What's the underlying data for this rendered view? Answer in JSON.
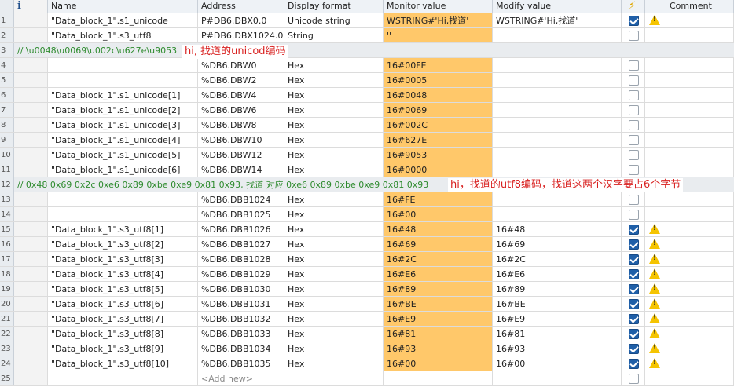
{
  "header": {
    "info_icon": "i",
    "name": "Name",
    "address": "Address",
    "display_format": "Display format",
    "monitor_value": "Monitor value",
    "modify_value": "Modify value",
    "bolt_icon": "⚡",
    "comment": "Comment"
  },
  "rows": [
    {
      "num": "1",
      "name": "\"Data_block_1\".s1_unicode",
      "address": "P#DB6.DBX0.0",
      "format": "Unicode string",
      "monitor": "WSTRING#'Hi,找道'",
      "modify": "WSTRING#'Hi,找道'",
      "checked": true,
      "warn": true
    },
    {
      "num": "2",
      "name": "\"Data_block_1\".s3_utf8",
      "address": "P#DB6.DBX1024.0",
      "format": "String",
      "monitor": "''",
      "modify": "",
      "checked": false,
      "warn": false
    },
    {
      "num": "3",
      "comment": "// \\u0048\\u0069\\u002c\\u627e\\u9053"
    },
    {
      "num": "4",
      "name": "",
      "address": "%DB6.DBW0",
      "format": "Hex",
      "monitor": "16#00FE",
      "modify": "",
      "checked": false,
      "warn": false
    },
    {
      "num": "5",
      "name": "",
      "address": "%DB6.DBW2",
      "format": "Hex",
      "monitor": "16#0005",
      "modify": "",
      "checked": false,
      "warn": false
    },
    {
      "num": "6",
      "name": "\"Data_block_1\".s1_unicode[1]",
      "address": "%DB6.DBW4",
      "format": "Hex",
      "monitor": "16#0048",
      "modify": "",
      "checked": false,
      "warn": false
    },
    {
      "num": "7",
      "name": "\"Data_block_1\".s1_unicode[2]",
      "address": "%DB6.DBW6",
      "format": "Hex",
      "monitor": "16#0069",
      "modify": "",
      "checked": false,
      "warn": false
    },
    {
      "num": "8",
      "name": "\"Data_block_1\".s1_unicode[3]",
      "address": "%DB6.DBW8",
      "format": "Hex",
      "monitor": "16#002C",
      "modify": "",
      "checked": false,
      "warn": false
    },
    {
      "num": "9",
      "name": "\"Data_block_1\".s1_unicode[4]",
      "address": "%DB6.DBW10",
      "format": "Hex",
      "monitor": "16#627E",
      "modify": "",
      "checked": false,
      "warn": false
    },
    {
      "num": "10",
      "name": "\"Data_block_1\".s1_unicode[5]",
      "address": "%DB6.DBW12",
      "format": "Hex",
      "monitor": "16#9053",
      "modify": "",
      "checked": false,
      "warn": false
    },
    {
      "num": "11",
      "name": "\"Data_block_1\".s1_unicode[6]",
      "address": "%DB6.DBW14",
      "format": "Hex",
      "monitor": "16#0000",
      "modify": "",
      "checked": false,
      "warn": false
    },
    {
      "num": "12",
      "comment": "// 0x48 0x69 0x2c 0xe6 0x89 0xbe 0xe9 0x81 0x93, 找道 对应 0xe6 0x89 0xbe 0xe9 0x81 0x93"
    },
    {
      "num": "13",
      "name": "",
      "address": "%DB6.DBB1024",
      "format": "Hex",
      "monitor": "16#FE",
      "modify": "",
      "checked": false,
      "warn": false
    },
    {
      "num": "14",
      "name": "",
      "address": "%DB6.DBB1025",
      "format": "Hex",
      "monitor": "16#00",
      "modify": "",
      "checked": false,
      "warn": false
    },
    {
      "num": "15",
      "name": "\"Data_block_1\".s3_utf8[1]",
      "address": "%DB6.DBB1026",
      "format": "Hex",
      "monitor": "16#48",
      "modify": "16#48",
      "checked": true,
      "warn": true
    },
    {
      "num": "16",
      "name": "\"Data_block_1\".s3_utf8[2]",
      "address": "%DB6.DBB1027",
      "format": "Hex",
      "monitor": "16#69",
      "modify": "16#69",
      "checked": true,
      "warn": true
    },
    {
      "num": "17",
      "name": "\"Data_block_1\".s3_utf8[3]",
      "address": "%DB6.DBB1028",
      "format": "Hex",
      "monitor": "16#2C",
      "modify": "16#2C",
      "checked": true,
      "warn": true
    },
    {
      "num": "18",
      "name": "\"Data_block_1\".s3_utf8[4]",
      "address": "%DB6.DBB1029",
      "format": "Hex",
      "monitor": "16#E6",
      "modify": "16#E6",
      "checked": true,
      "warn": true
    },
    {
      "num": "19",
      "name": "\"Data_block_1\".s3_utf8[5]",
      "address": "%DB6.DBB1030",
      "format": "Hex",
      "monitor": "16#89",
      "modify": "16#89",
      "checked": true,
      "warn": true
    },
    {
      "num": "20",
      "name": "\"Data_block_1\".s3_utf8[6]",
      "address": "%DB6.DBB1031",
      "format": "Hex",
      "monitor": "16#BE",
      "modify": "16#BE",
      "checked": true,
      "warn": true
    },
    {
      "num": "21",
      "name": "\"Data_block_1\".s3_utf8[7]",
      "address": "%DB6.DBB1032",
      "format": "Hex",
      "monitor": "16#E9",
      "modify": "16#E9",
      "checked": true,
      "warn": true
    },
    {
      "num": "22",
      "name": "\"Data_block_1\".s3_utf8[8]",
      "address": "%DB6.DBB1033",
      "format": "Hex",
      "monitor": "16#81",
      "modify": "16#81",
      "checked": true,
      "warn": true
    },
    {
      "num": "23",
      "name": "\"Data_block_1\".s3_utf8[9]",
      "address": "%DB6.DBB1034",
      "format": "Hex",
      "monitor": "16#93",
      "modify": "16#93",
      "checked": true,
      "warn": true
    },
    {
      "num": "24",
      "name": "\"Data_block_1\".s3_utf8[10]",
      "address": "%DB6.DBB1035",
      "format": "Hex",
      "monitor": "16#00",
      "modify": "16#00",
      "checked": true,
      "warn": true
    }
  ],
  "add_row": {
    "num": "25",
    "add_new": "<Add new>"
  },
  "notes": {
    "unicode_note": "hi, 找道的unicod编码",
    "utf8_note": "hi，找道的utf8编码，找道这两个汉字要占6个字节"
  },
  "colors": {
    "monitor_highlight": "#ffc86a",
    "note_red": "#d8201f",
    "comment_green": "#2e8b2e"
  },
  "icons": {
    "checked": "checkbox-checked-icon",
    "warning": "warning-triangle-icon"
  }
}
